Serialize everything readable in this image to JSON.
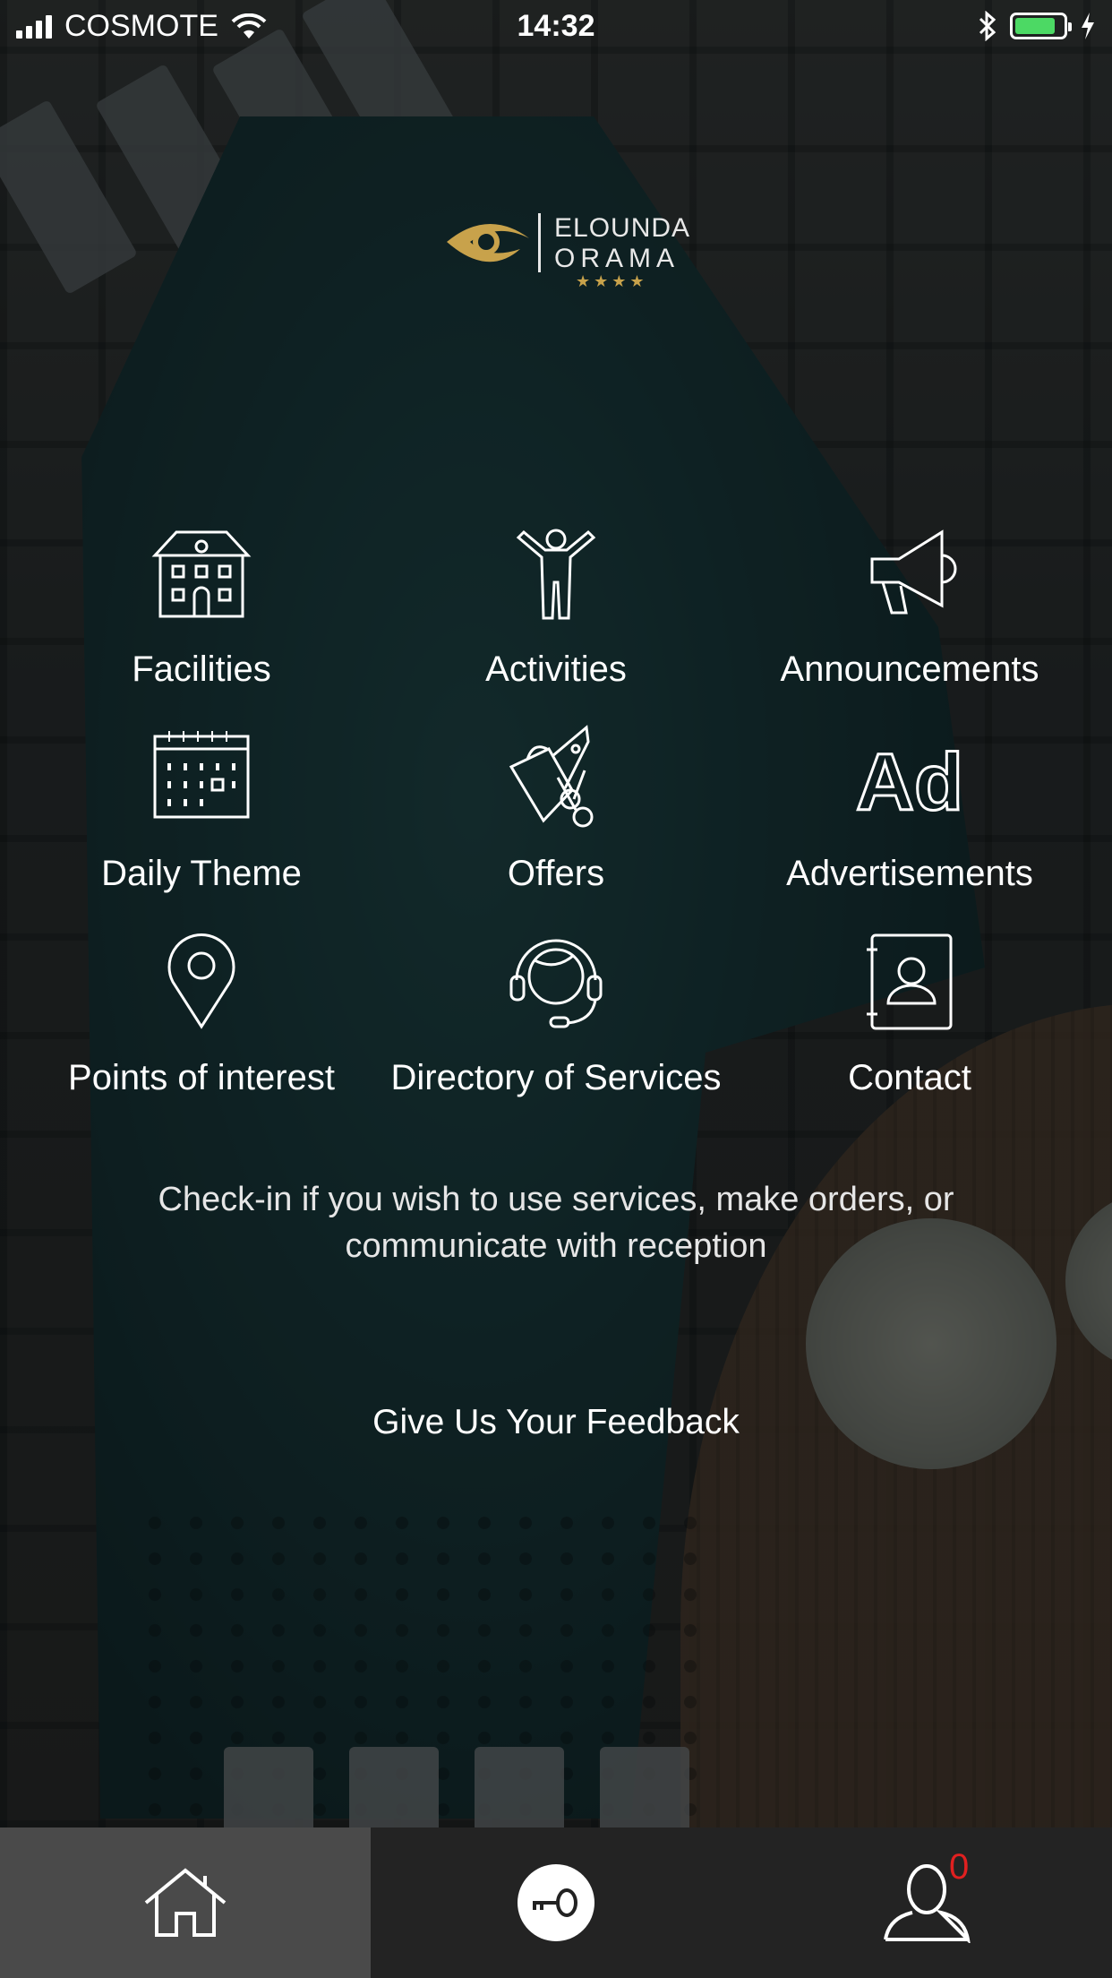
{
  "status_bar": {
    "carrier": "COSMOTE",
    "time": "14:32",
    "battery_color": "#4cd964"
  },
  "logo": {
    "line1": "ELOUNDA",
    "line2": "ORAMA",
    "stars": "★★★★",
    "gold": "#c8a24b"
  },
  "menu": [
    {
      "label": "Facilities",
      "icon": "house-icon"
    },
    {
      "label": "Activities",
      "icon": "person-raised-arms-icon"
    },
    {
      "label": "Announcements",
      "icon": "megaphone-icon"
    },
    {
      "label": "Daily Theme",
      "icon": "calendar-icon"
    },
    {
      "label": "Offers",
      "icon": "shopping-bag-tag-icon"
    },
    {
      "label": "Advertisements",
      "icon": "ad-icon"
    },
    {
      "label": "Points of interest",
      "icon": "map-pin-icon"
    },
    {
      "label": "Directory of Services",
      "icon": "headset-operator-icon"
    },
    {
      "label": "Contact",
      "icon": "contact-book-icon"
    }
  ],
  "checkin_text": "Check-in if you wish to use services, make orders, or communicate with reception",
  "feedback_label": "Give Us Your Feedback",
  "tab_bar": {
    "home_icon": "home-icon",
    "key_icon": "key-icon",
    "profile_icon": "user-icon",
    "badge_count": "0",
    "badge_color": "#e02020"
  }
}
